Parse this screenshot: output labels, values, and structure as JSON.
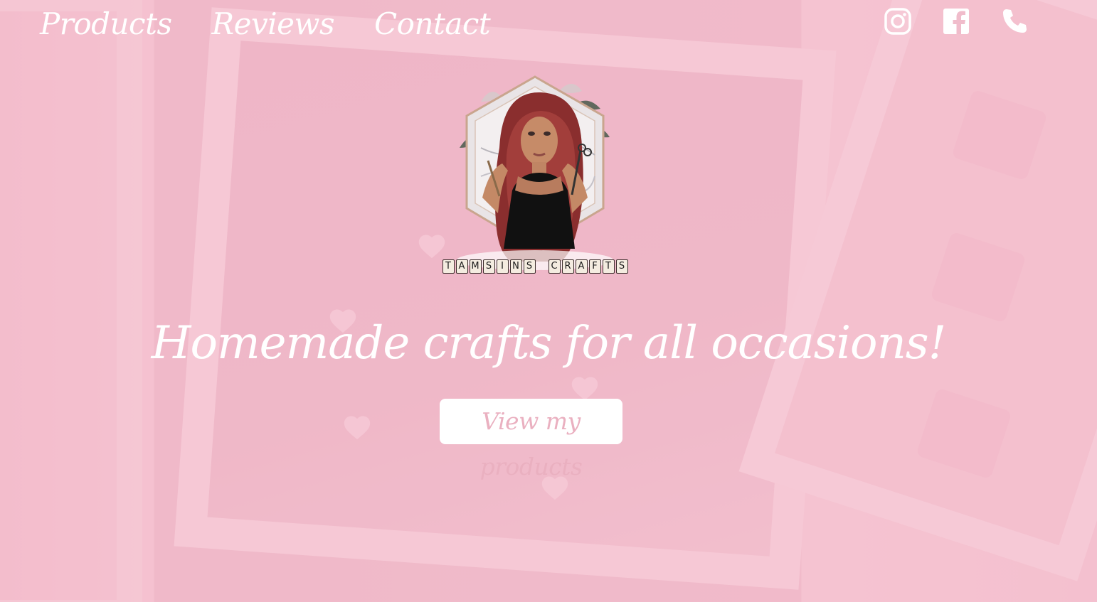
{
  "nav": {
    "items": [
      {
        "label": "Products"
      },
      {
        "label": "Reviews"
      },
      {
        "label": "Contact"
      }
    ]
  },
  "social": {
    "icons": [
      "instagram-icon",
      "facebook-icon",
      "phone-icon"
    ]
  },
  "logo": {
    "tiles": [
      "T",
      "A",
      "M",
      "S",
      "I",
      "N",
      "S",
      " ",
      "C",
      "R",
      "A",
      "F",
      "T",
      "S"
    ]
  },
  "hero": {
    "title": "Homemade crafts for all occasions!",
    "cta_label": "View my products"
  },
  "colors": {
    "background": "#f4c4d0",
    "text": "#ffffff",
    "cta_text": "#eab0c0"
  }
}
